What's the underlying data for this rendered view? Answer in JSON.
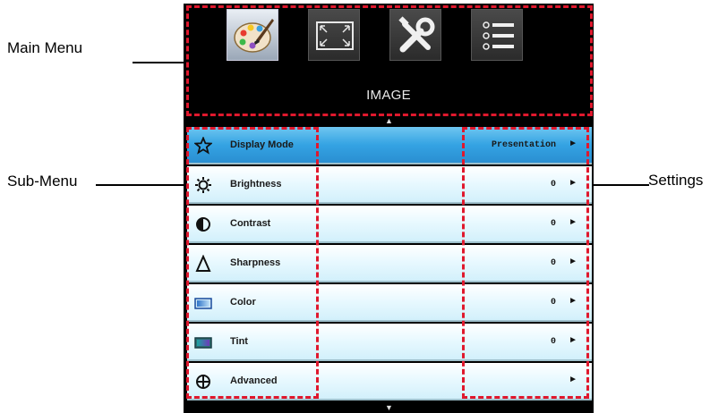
{
  "callouts": {
    "main_menu": "Main Menu",
    "sub_menu": "Sub-Menu",
    "settings": "Settings"
  },
  "osd": {
    "tabs": [
      {
        "icon": "palette-icon",
        "active": true
      },
      {
        "icon": "screen-resize-icon",
        "active": false
      },
      {
        "icon": "tools-icon",
        "active": false
      },
      {
        "icon": "list-icon",
        "active": false
      }
    ],
    "title": "IMAGE",
    "items": [
      {
        "label": "Display Mode",
        "value": "Presentation",
        "icon": "star-icon",
        "selected": true
      },
      {
        "label": "Brightness",
        "value": "0",
        "icon": "sun-icon",
        "selected": false
      },
      {
        "label": "Contrast",
        "value": "0",
        "icon": "contrast-icon",
        "selected": false
      },
      {
        "label": "Sharpness",
        "value": "0",
        "icon": "delta-icon",
        "selected": false
      },
      {
        "label": "Color",
        "value": "0",
        "icon": "color-swatch-icon",
        "selected": false
      },
      {
        "label": "Tint",
        "value": "0",
        "icon": "tint-swatch-icon",
        "selected": false
      },
      {
        "label": "Advanced",
        "value": "",
        "icon": "plus-circle-icon",
        "selected": false
      }
    ],
    "arrow_glyph": "►",
    "scroll_up": "▲",
    "scroll_down": "▼"
  },
  "colors": {
    "highlight_dash": "#e0182d",
    "selected_row": "#34a3e3",
    "row_bg": "#e2f6fd"
  }
}
